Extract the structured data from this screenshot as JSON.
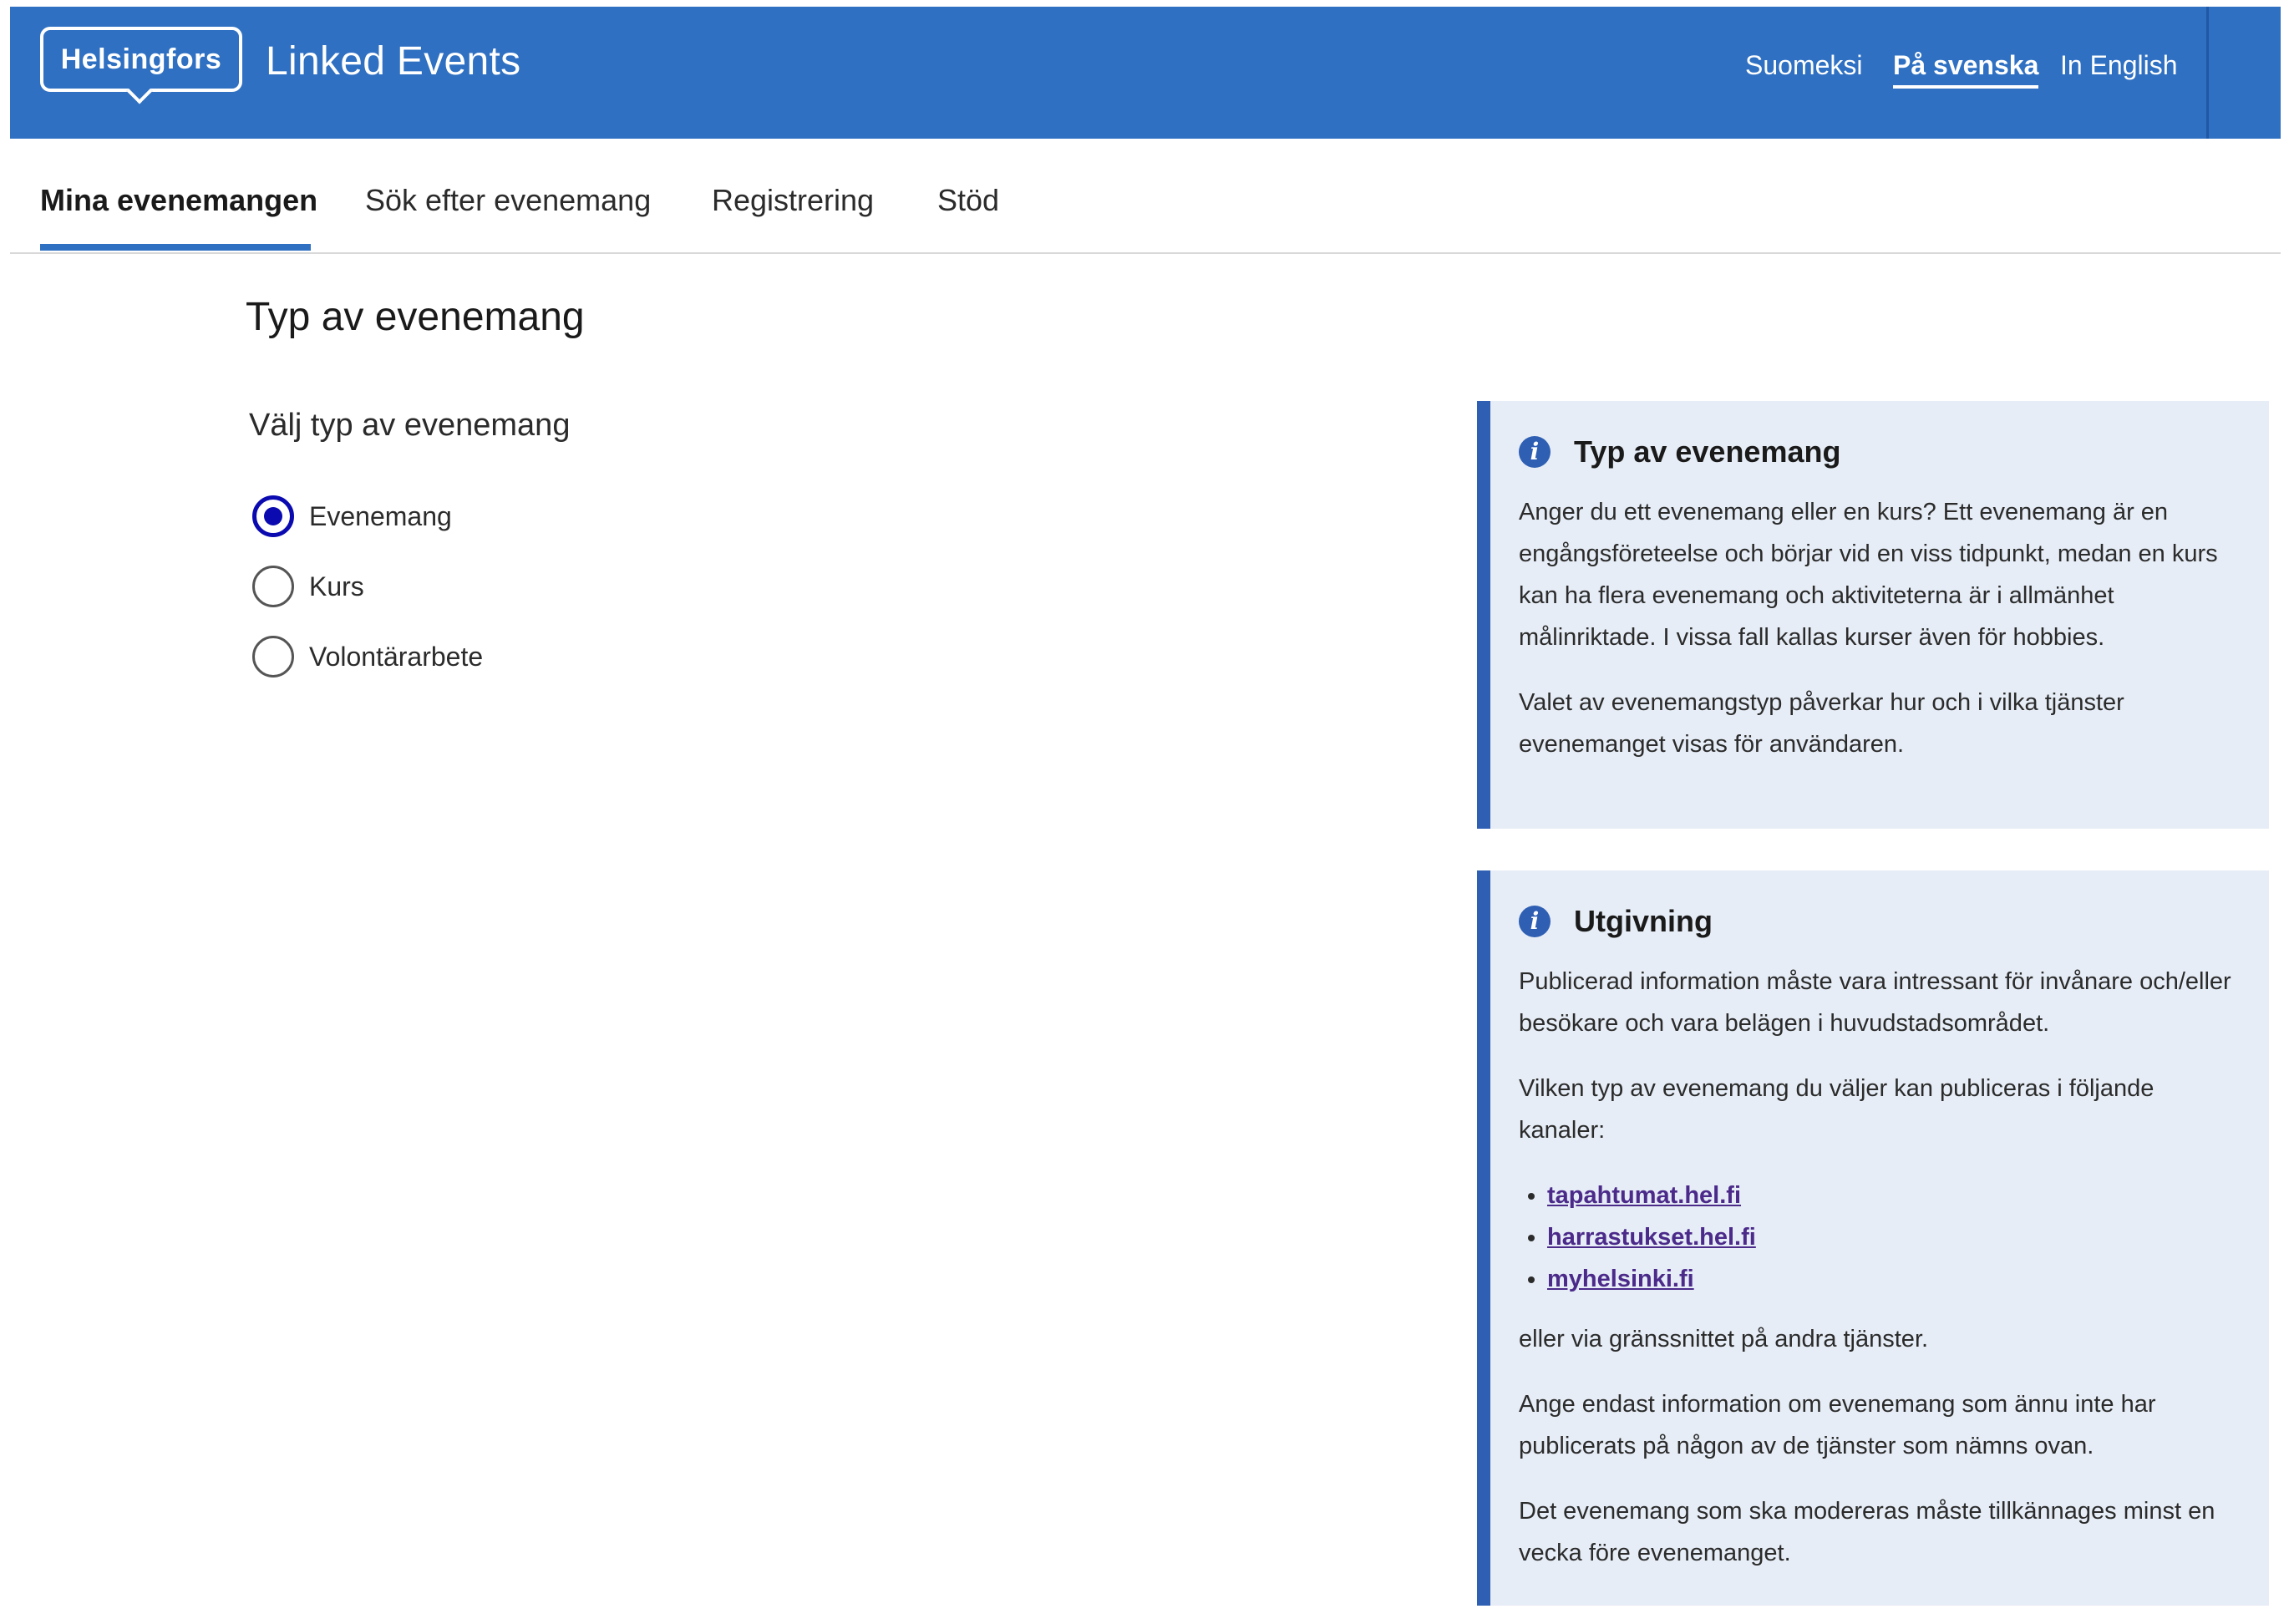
{
  "header": {
    "logo_text": "Helsingfors",
    "app_title": "Linked Events",
    "languages": [
      {
        "label": "Suomeksi",
        "active": false
      },
      {
        "label": "På svenska",
        "active": true
      },
      {
        "label": "In English",
        "active": false
      }
    ],
    "brand_color": "#2f70c2"
  },
  "nav": {
    "tabs": [
      {
        "label": "Mina evenemangen",
        "active": true
      },
      {
        "label": "Sök efter evenemang",
        "active": false
      },
      {
        "label": "Registrering",
        "active": false
      },
      {
        "label": "Stöd",
        "active": false
      }
    ]
  },
  "main": {
    "page_title": "Typ av evenemang",
    "group_label": "Välj typ av evenemang",
    "options": [
      {
        "label": "Evenemang",
        "checked": true
      },
      {
        "label": "Kurs",
        "checked": false
      },
      {
        "label": "Volontärarbete",
        "checked": false
      }
    ]
  },
  "info_boxes": [
    {
      "icon": "info-icon",
      "title": "Typ av evenemang",
      "paragraphs": [
        "Anger du ett evenemang eller en kurs? Ett evenemang är en engångsföreteelse och börjar vid en viss tidpunkt, medan en kurs kan ha flera evenemang och aktiviteterna är i allmänhet målinriktade. I vissa fall kallas kurser även för hobbies.",
        "Valet av evenemangstyp påverkar hur och i vilka tjänster evenemanget visas för användaren."
      ]
    },
    {
      "icon": "info-icon",
      "title": "Utgivning",
      "paragraphs_before": [
        "Publicerad information måste vara intressant för invånare och/eller besökare och vara belägen i huvudstadsområdet.",
        "Vilken typ av evenemang du väljer kan publiceras i följande kanaler:"
      ],
      "links": [
        "tapahtumat.hel.fi",
        "harrastukset.hel.fi",
        "myhelsinki.fi"
      ],
      "paragraphs_after": [
        "eller via gränssnittet på andra tjänster.",
        "Ange endast information om evenemang som ännu inte har publicerats på någon av de tjänster som nämns ovan.",
        "Det evenemang som ska modereras måste tillkännages minst en vecka före evenemanget."
      ]
    }
  ]
}
